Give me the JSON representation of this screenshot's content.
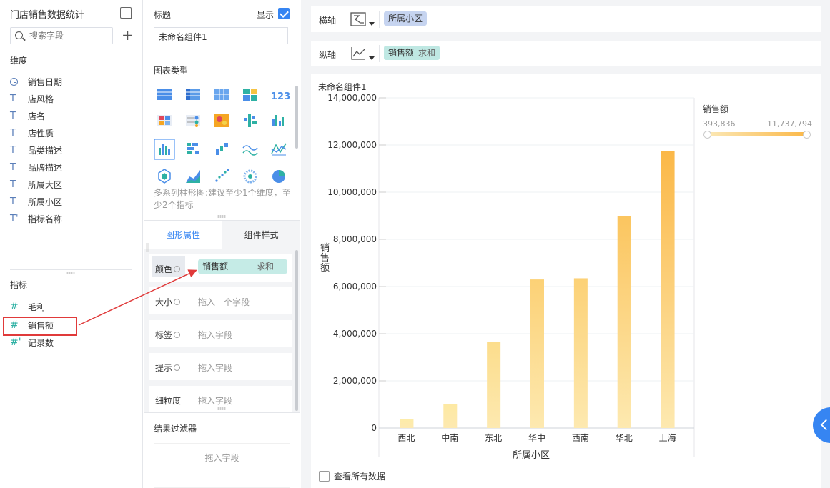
{
  "left_panel": {
    "title": "门店销售数据统计",
    "search_placeholder": "搜索字段",
    "dimensions_label": "维度",
    "dimensions": [
      "销售日期",
      "店风格",
      "店名",
      "店性质",
      "品类描述",
      "品牌描述",
      "所属大区",
      "所属小区",
      "指标名称"
    ],
    "metrics_label": "指标",
    "metrics": [
      "毛利",
      "销售额",
      "记录数"
    ]
  },
  "mid_panel": {
    "title_label": "标题",
    "show_label": "显示",
    "title_value": "未命名组件1",
    "chart_type_label": "图表类型",
    "chart_hint": "多系列柱形图:建议至少1个维度，至少2个指标",
    "tabs": [
      "图形属性",
      "组件样式"
    ],
    "props": {
      "color_label": "颜色",
      "color_field": "销售额",
      "color_agg": "求和",
      "size_label": "大小",
      "size_placeholder": "拖入一个字段",
      "tag_label": "标签",
      "tag_placeholder": "拖入字段",
      "tip_label": "提示",
      "tip_placeholder": "拖入字段",
      "grain_label": "细粒度",
      "grain_placeholder": "拖入字段"
    },
    "filter_label": "结果过滤器",
    "filter_placeholder": "拖入字段"
  },
  "axis": {
    "x_label": "横轴",
    "x_field": "所属小区",
    "y_label": "纵轴",
    "y_field": "销售额",
    "y_agg": "求和"
  },
  "chart_card": {
    "title": "未命名组件1",
    "legend_title": "销售额",
    "legend_min": "393,836",
    "legend_max": "11,737,794",
    "view_all_label": "查看所有数据"
  },
  "colors": {
    "accent": "#3685f2",
    "bar_light": "#fde9a6",
    "bar_dark": "#fbb848",
    "highlight": "#e03a3a"
  },
  "chart_data": {
    "type": "bar",
    "categories": [
      "西北",
      "中南",
      "东北",
      "华中",
      "西南",
      "华北",
      "上海"
    ],
    "values": [
      393836,
      1000000,
      3650000,
      6300000,
      6350000,
      9000000,
      11737794
    ],
    "xlabel": "所属小区",
    "ylabel": "销售额",
    "ylim": [
      0,
      14000000
    ],
    "yticks": [
      "0",
      "2,000,000",
      "4,000,000",
      "6,000,000",
      "8,000,000",
      "10,000,000",
      "12,000,000",
      "14,000,000"
    ],
    "grid": true,
    "legend": "right"
  }
}
